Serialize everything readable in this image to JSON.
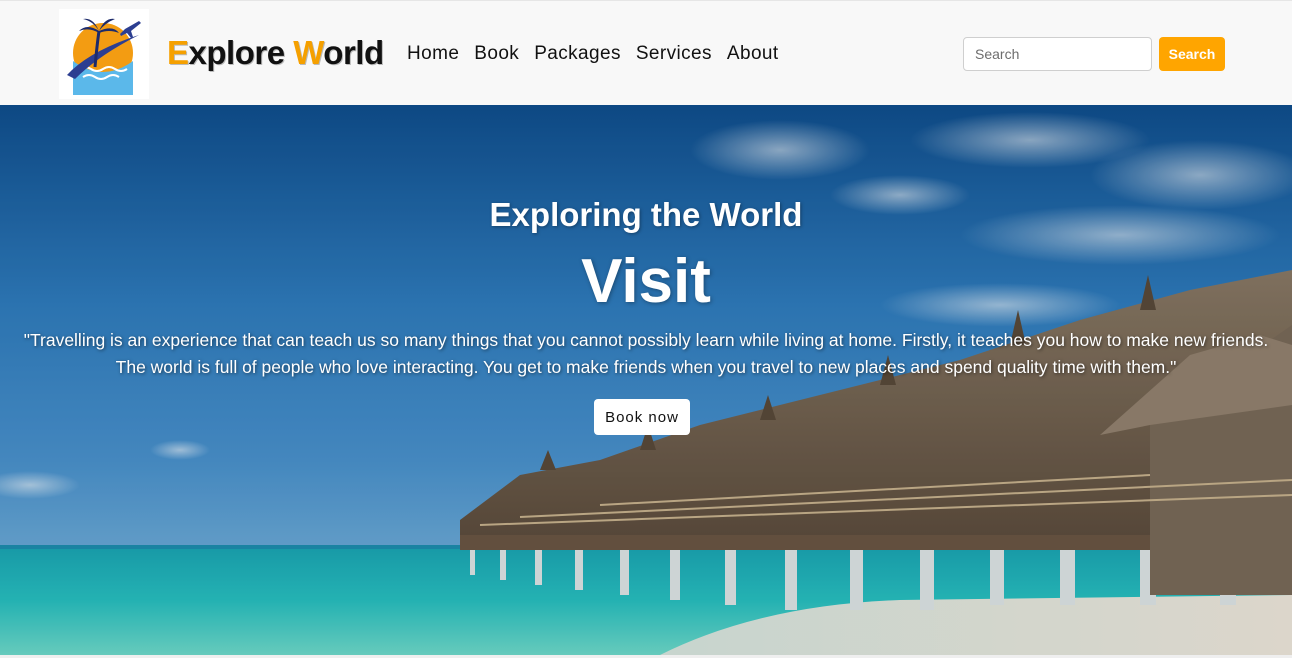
{
  "header": {
    "brand": {
      "first_letter": "E",
      "first_rest": "xplore ",
      "second_letter": "W",
      "second_rest": "orld"
    },
    "nav": [
      "Home",
      "Book",
      "Packages",
      "Services",
      "About"
    ],
    "search": {
      "placeholder": "Search",
      "value": "",
      "button_label": "Search"
    },
    "logo_icon": "palm-tree-airplane-logo-icon"
  },
  "hero": {
    "subtitle": "Exploring the World",
    "title": "Visit",
    "quote_line1": "\"Travelling is an experience that can teach us so many things that you cannot possibly learn while living at home. Firstly, it teaches you how to make new friends.",
    "quote_line2": "The world is full of people who love interacting. You get to make friends when you travel to new places and spend quality time with them.\"",
    "cta_label": "Book now"
  },
  "colors": {
    "accent": "#ffa500",
    "brand_accent": "#f5a000",
    "navbar_bg": "#f8f8f8",
    "text_dark": "#111111"
  }
}
